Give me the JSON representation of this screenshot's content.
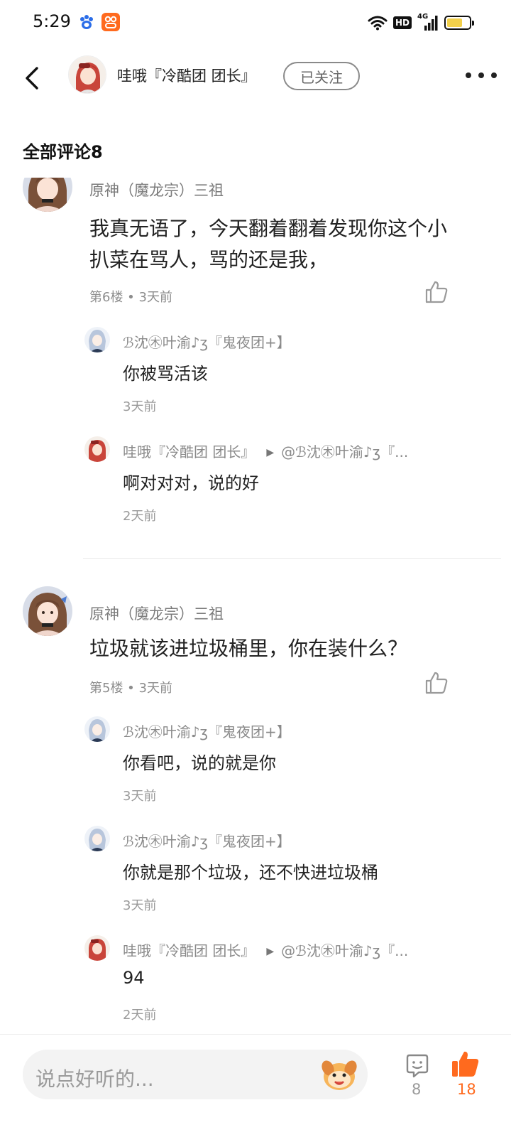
{
  "status_bar": {
    "time": "5:29",
    "hd_label": "HD",
    "network_label": "4G",
    "battery_level": 0.7
  },
  "header": {
    "author_name": "哇哦『冷酷团 团长』",
    "follow_label": "已关注"
  },
  "comments_section": {
    "title": "全部评论8"
  },
  "comments": [
    {
      "author": "原神（魔龙宗）三祖",
      "text": "我真无语了，今天翻着翻着发现你这个小扒菜在骂人，骂的还是我，",
      "meta": "第6楼 • 3天前",
      "replies": [
        {
          "author": "ℬ沈㊍叶渝♪ʒ『鬼夜团+】",
          "target": "",
          "text": "你被骂活该",
          "time": "3天前"
        },
        {
          "author": "哇哦『冷酷团 团长』",
          "target": "@ℬ沈㊍叶渝♪ʒ『...",
          "text": "啊对对对，说的好",
          "time": "2天前"
        }
      ]
    },
    {
      "author": "原神（魔龙宗）三祖",
      "text": "垃圾就该进垃圾桶里，你在装什么？",
      "meta": "第5楼 • 3天前",
      "replies": [
        {
          "author": "ℬ沈㊍叶渝♪ʒ『鬼夜团+】",
          "target": "",
          "text": "你看吧，说的就是你",
          "time": "3天前"
        },
        {
          "author": "ℬ沈㊍叶渝♪ʒ『鬼夜团+】",
          "target": "",
          "text": "你就是那个垃圾，还不快进垃圾桶",
          "time": "3天前"
        },
        {
          "author": "哇哦『冷酷团 团长』",
          "target": "@ℬ沈㊍叶渝♪ʒ『...",
          "text": "94",
          "time": "2天前"
        }
      ]
    }
  ],
  "bottom_bar": {
    "input_placeholder": "说点好听的...",
    "comment_count": "8",
    "like_count": "18"
  },
  "colors": {
    "accent": "#ff6a1e",
    "muted_text": "#8c8c8c",
    "input_bg": "#f3f3f3"
  }
}
